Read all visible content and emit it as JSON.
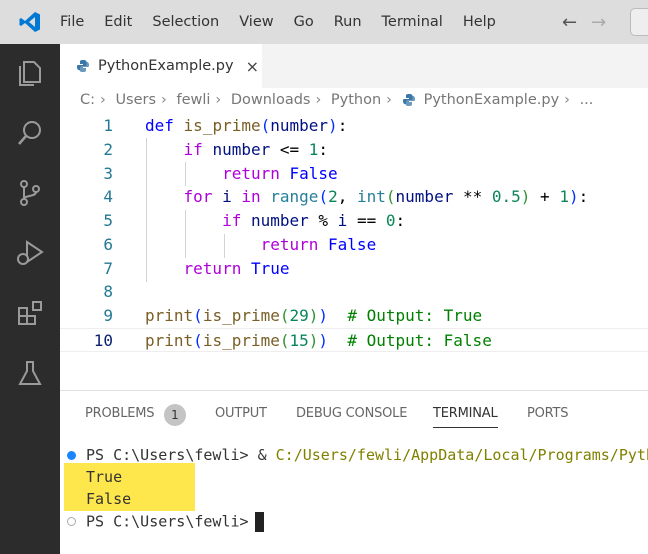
{
  "menu": [
    "File",
    "Edit",
    "Selection",
    "View",
    "Go",
    "Run",
    "Terminal",
    "Help"
  ],
  "nav": {
    "back": "←",
    "forward": "→"
  },
  "tab": {
    "filename": "PythonExample.py",
    "close": "×"
  },
  "breadcrumbs": [
    "C:",
    "Users",
    "fewli",
    "Downloads",
    "Python",
    "PythonExample.py",
    "..."
  ],
  "code": {
    "lines": [
      "1",
      "2",
      "3",
      "4",
      "5",
      "6",
      "7",
      "8",
      "9",
      "10"
    ]
  },
  "panel": {
    "tabs": [
      "PROBLEMS",
      "OUTPUT",
      "DEBUG CONSOLE",
      "TERMINAL",
      "PORTS"
    ],
    "problems_count": "1",
    "active_tab": "TERMINAL"
  },
  "terminal": {
    "prompt": "PS C:\\Users\\fewli>",
    "command_amp": "&",
    "command_path": "C:/Users/fewli/AppData/Local/Programs/Pyth",
    "output": [
      "True",
      "False"
    ],
    "highlight_color": "#fde74c"
  },
  "colors": {
    "activity_bar": "#2c2c2c",
    "accent": "#007acc"
  }
}
